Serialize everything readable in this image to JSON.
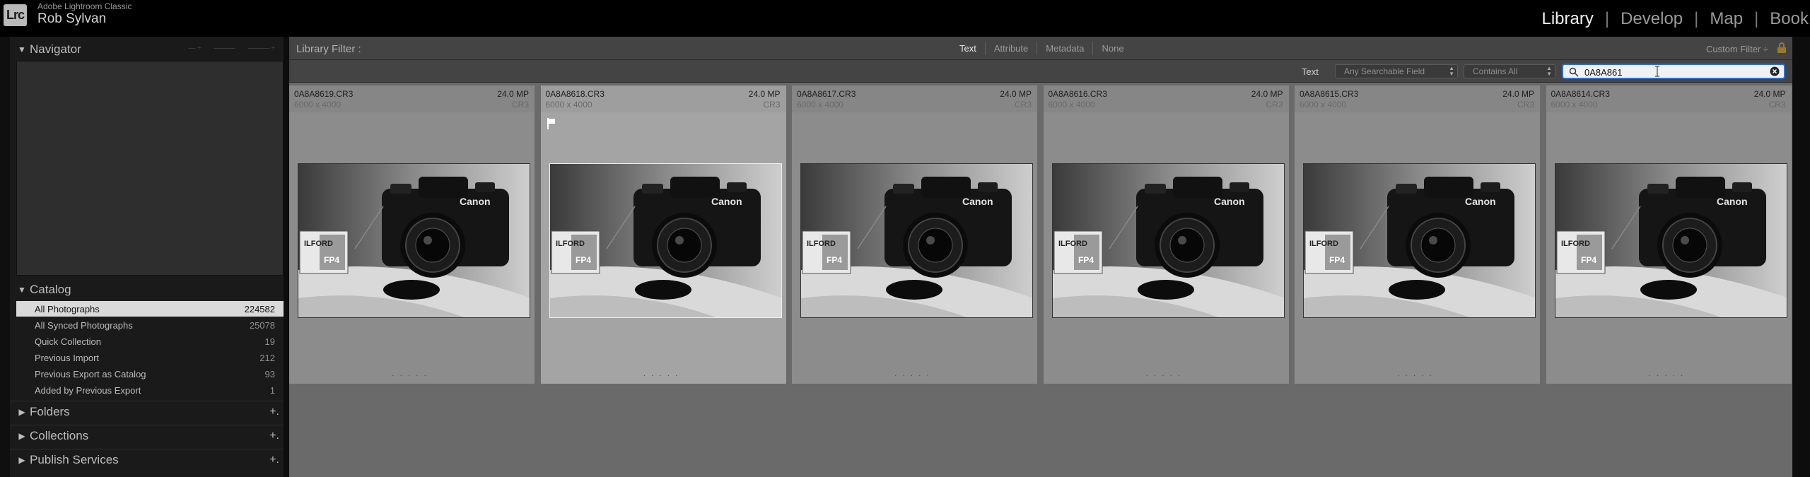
{
  "app": {
    "name": "Adobe Lightroom Classic",
    "logo": "Lrc",
    "user": "Rob Sylvan"
  },
  "modules": [
    {
      "label": "Library",
      "active": true
    },
    {
      "label": "Develop",
      "active": false
    },
    {
      "label": "Map",
      "active": false
    },
    {
      "label": "Book",
      "active": false
    }
  ],
  "left_panel": {
    "navigator": {
      "title": "Navigator"
    },
    "catalog": {
      "title": "Catalog",
      "items": [
        {
          "label": "All Photographs",
          "count": "224582",
          "selected": true
        },
        {
          "label": "All Synced Photographs",
          "count": "25078"
        },
        {
          "label": "Quick Collection",
          "count": "19"
        },
        {
          "label": "Previous Import",
          "count": "212"
        },
        {
          "label": "Previous Export as Catalog",
          "count": "93"
        },
        {
          "label": "Added by Previous Export",
          "count": "1"
        }
      ]
    },
    "folders": {
      "title": "Folders"
    },
    "collections": {
      "title": "Collections"
    },
    "publish": {
      "title": "Publish Services"
    }
  },
  "filter_bar": {
    "title": "Library Filter :",
    "tabs": [
      "Text",
      "Attribute",
      "Metadata",
      "None"
    ],
    "active_tab": "Text",
    "custom_filter": "Custom Filter ÷",
    "text_label": "Text",
    "field_dropdown": "Any Searchable Field",
    "rule_dropdown": "Contains All",
    "search_value": "0A8A861"
  },
  "photos": [
    {
      "name": "0A8A8619.CR3",
      "mp": "24.0 MP",
      "dims": "6000 x 4000",
      "ext": "CR3",
      "selected": false,
      "flagged": false
    },
    {
      "name": "0A8A8618.CR3",
      "mp": "24.0 MP",
      "dims": "6000 x 4000",
      "ext": "CR3",
      "selected": true,
      "flagged": true
    },
    {
      "name": "0A8A8617.CR3",
      "mp": "24.0 MP",
      "dims": "6000 x 4000",
      "ext": "CR3",
      "selected": false,
      "flagged": false
    },
    {
      "name": "0A8A8616.CR3",
      "mp": "24.0 MP",
      "dims": "6000 x 4000",
      "ext": "CR3",
      "selected": false,
      "flagged": false
    },
    {
      "name": "0A8A8615.CR3",
      "mp": "24.0 MP",
      "dims": "6000 x 4000",
      "ext": "CR3",
      "selected": false,
      "flagged": false
    },
    {
      "name": "0A8A8614.CR3",
      "mp": "24.0 MP",
      "dims": "6000 x 4000",
      "ext": "CR3",
      "selected": false,
      "flagged": false
    }
  ],
  "thumbnail_text": {
    "brand": "Canon",
    "film": "ILFORD",
    "film_type": "FP4"
  },
  "colors": {
    "accent": "#2f6fd0",
    "selected_row": "#d9d9d9",
    "grid_bg": "#6a6a6a"
  }
}
